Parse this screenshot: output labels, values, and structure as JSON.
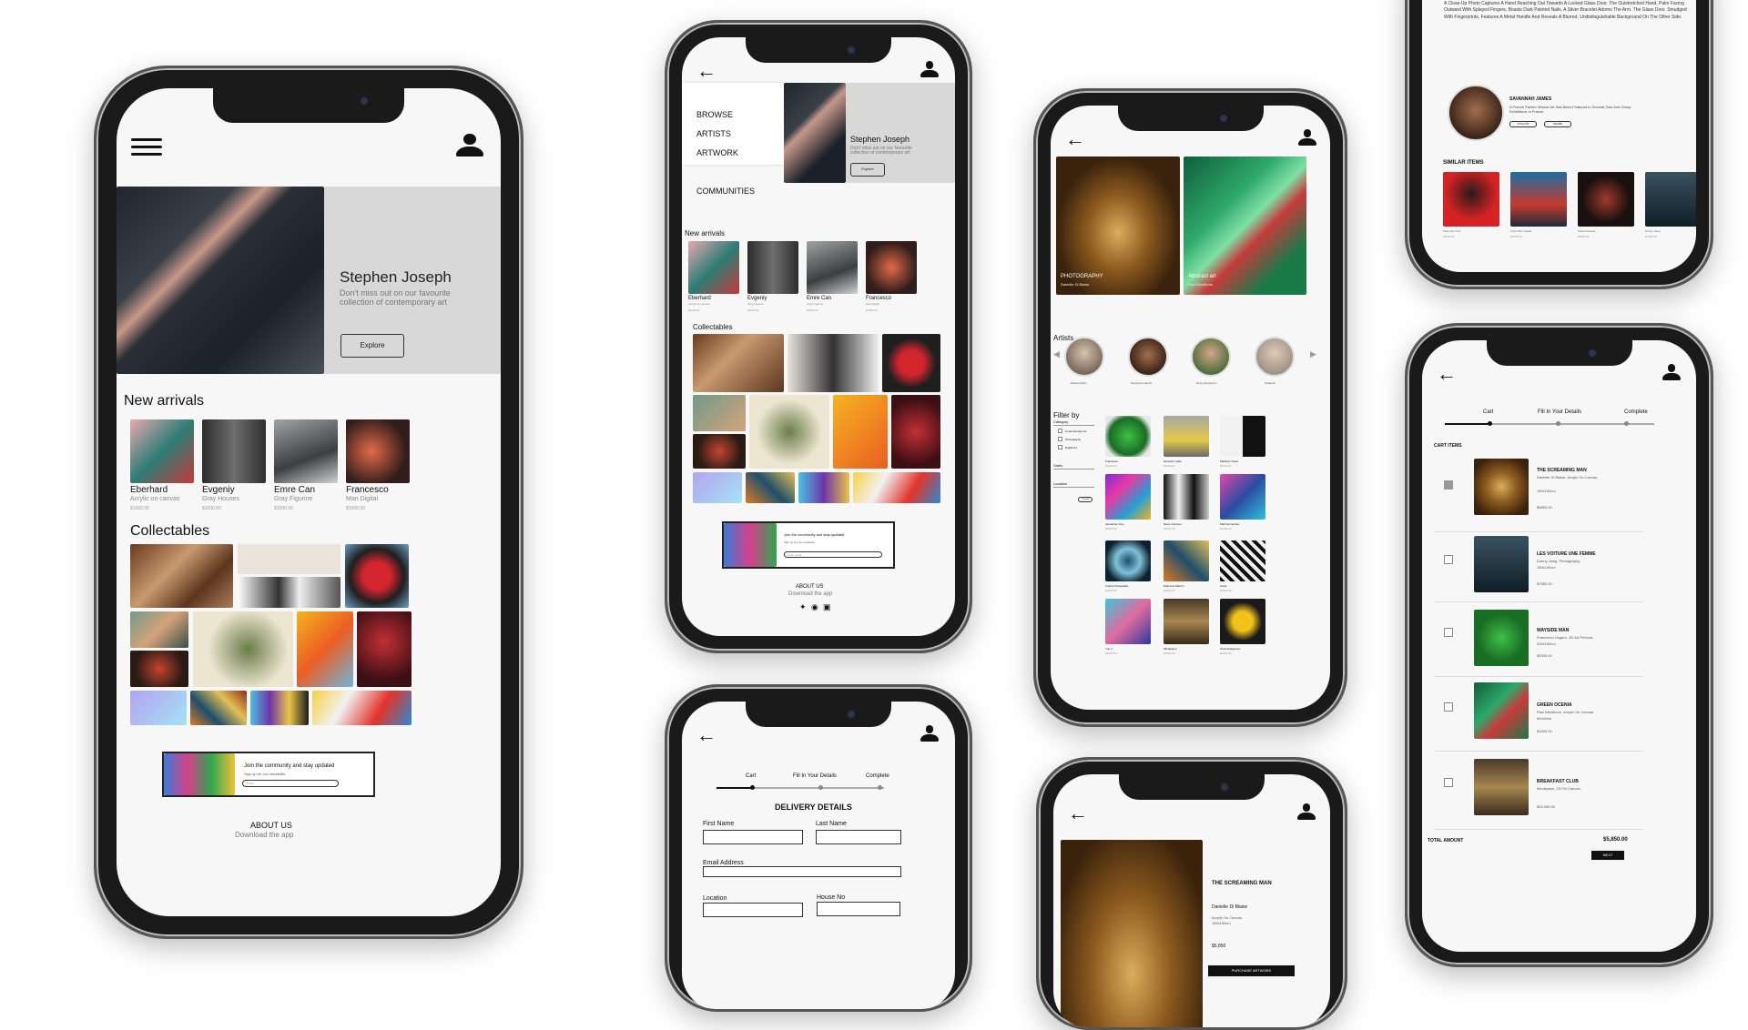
{
  "phone1": {
    "hero_title": "Stephen Joseph",
    "hero_sub": "Don't miss out on our favourite collection of contemporary art",
    "explore": "Explore",
    "new_arrivals": "New arrivals",
    "arrivals": [
      {
        "name": "Eberhard",
        "sub": "Acrylic on canvas",
        "price": "$1000.00"
      },
      {
        "name": "Evgeniy",
        "sub": "Gray Houses",
        "price": "$1000.00"
      },
      {
        "name": "Emre Can",
        "sub": "Gray Figurine",
        "price": "$1000.00"
      },
      {
        "name": "Francesco",
        "sub": "Man Digital",
        "price": "$1000.00"
      }
    ],
    "collectables": "Collectables",
    "community_title": "Join the community and stay updated",
    "community_sub": "Sign up for our newsletter",
    "email_placeholder": "Email",
    "about": "ABOUT US",
    "download": "Download the app"
  },
  "phone2": {
    "menu": [
      "BROWSE",
      "ARTISTS",
      "ARTWORK",
      "COMMUNITIES"
    ],
    "hero_title": "Stephen Joseph",
    "hero_sub": "Don't miss out on our favourite collection of contemporary art",
    "explore": "Explore",
    "new_arrivals": "New arrivals",
    "arrivals": [
      {
        "name": "Eberhard",
        "sub": "Acrylic on canvas",
        "price": "$1000.00"
      },
      {
        "name": "Evgeniy",
        "sub": "Gray Houses",
        "price": "$1000.00"
      },
      {
        "name": "Emre Can",
        "sub": "Gray Figurine",
        "price": "$1000.00"
      },
      {
        "name": "Francesco",
        "sub": "Man Digital",
        "price": "$1000.00"
      }
    ],
    "collectables": "Collectables",
    "community_title": "Join the community and stay updated",
    "community_sub": "Sign up for our newsletter",
    "email_placeholder": "Enter email",
    "about": "ABOUT US",
    "download": "Download the app"
  },
  "phone3": {
    "steps": [
      "Cart",
      "Fill In Your Details",
      "Complete"
    ],
    "title": "DELIVERY DETAILS",
    "first_name": "First Name",
    "last_name": "Last Name",
    "email": "Email Address",
    "location": "Location",
    "house": "House No"
  },
  "phone4": {
    "cat1": "PHOTOGRAPHY",
    "cat1_sub": "Danielle Di Blaise",
    "cat2": "Abstract art",
    "cat2_sub": "Paul Blankhorn",
    "artists_label": "Artists",
    "artists": [
      "Joshua Martin",
      "Savannah James",
      "Ruby Henderson",
      "Nadia Ali"
    ],
    "filter_by": "Filter by",
    "category": "Category",
    "cat_opts": [
      "Contemporary Art",
      "Photography",
      "Digital Art"
    ],
    "sales": "Sales",
    "location": "Location",
    "clear": "Clear All",
    "grid": [
      {
        "name": "Francesco",
        "price": "$1000.00"
      },
      {
        "name": "Giovanni Calla",
        "price": "$1000.00"
      },
      {
        "name": "Matheus Viana",
        "price": "$1000.00"
      },
      {
        "name": "Alexander Grey",
        "price": "$1000.00"
      },
      {
        "name": "Steve Johnson",
        "price": "$1000.00"
      },
      {
        "name": "Matt Fernandes",
        "price": "$1000.00"
      },
      {
        "name": "Andrea Piacquadio",
        "price": "$1000.00"
      },
      {
        "name": "Raimond Klavins",
        "price": "$1000.00"
      },
      {
        "name": "Liana",
        "price": "$1000.00"
      },
      {
        "name": "Yuu J",
        "price": "$1000.00"
      },
      {
        "name": "Mindspace",
        "price": "$1000.00"
      },
      {
        "name": "Scott Rodgerson",
        "price": "$1000.00"
      }
    ]
  },
  "phone5": {
    "title": "THE SCREAMING MAN",
    "artist": "Danielle Di Blaise",
    "details": "Acrylic On Canvas,",
    "size": "150x150cm",
    "price": "$5,850",
    "button": "PURCHASE ARTWORK"
  },
  "phone6": {
    "desc": "A Close-Up Photo Captures A Hand Reaching Out Towards A Locked Glass Door. The Outstretched Hand, Palm Facing Outward With Splayed Fingers, Boasts Dark Painted Nails. A Silver Bracelet Adorns The Arm. The Glass Door, Smudged With Fingerprints, Features A Metal Handle And Reveals A Blurred, Undistinguishable Background On The Other Side.",
    "artist_name": "SAVANNAH JAMES",
    "artist_bio": "A French Painter Whose Art Has Been Featured In Several Solo And Group Exhibitions In France.",
    "follow": "FOLLOW",
    "share": "SHARE",
    "similar": "SIMILAR ITEMS",
    "items": [
      {
        "name": "Sherman Trotz",
        "price": "$1000.00"
      },
      {
        "name": "Ouzei Ben Sosah",
        "price": "$1000.00"
      },
      {
        "name": "Sasha Kaunas",
        "price": "$1000.00"
      },
      {
        "name": "Donny Jiang",
        "price": "$1000.00"
      }
    ]
  },
  "phone7": {
    "steps": [
      "Cart",
      "Fill In Your Details",
      "Complete"
    ],
    "cart_items": "CART ITEMS",
    "items": [
      {
        "title": "THE SCREAMING MAN",
        "desc": "Danielle Di Blaise, Acrylic On Canvas,",
        "size": "150x150cm",
        "price": "$5850.00"
      },
      {
        "title": "LES VOITURE UNE FEMME",
        "desc": "Donny Jiang, Photography,",
        "size": "150x150cm",
        "price": "$7580.00"
      },
      {
        "title": "WAYSIDE MAN",
        "desc": "Francesco Ungaro, 3D Art Printout,",
        "size": "200x150cm",
        "price": "$2000.00"
      },
      {
        "title": "GREEN OCENIA",
        "desc": "Paul Blenkhorn, Acrylic On Canvas,",
        "size": "60x40cm",
        "price": "$1000.00"
      },
      {
        "title": "BREAKFAST CLUB",
        "desc": "Mindspace, Oil On Canvas,",
        "size": "",
        "price": "$25,390.00"
      }
    ],
    "total_label": "TOTAL AMOUNT",
    "total_value": "$5,850.00",
    "next": "NEXT"
  }
}
